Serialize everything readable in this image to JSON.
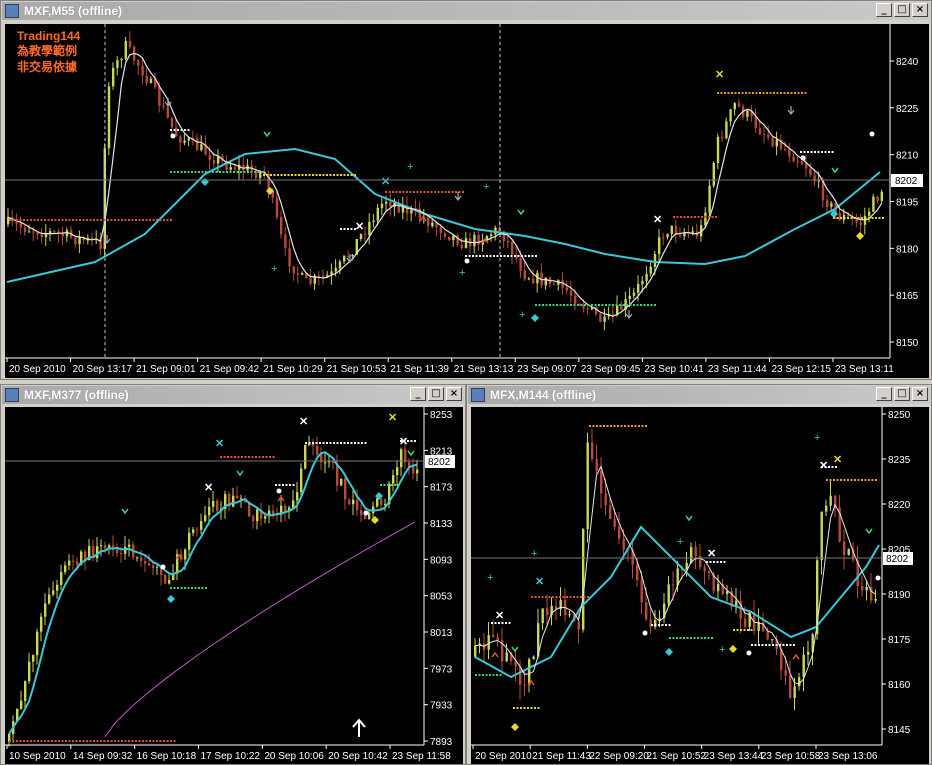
{
  "windows": {
    "top": {
      "title": "MXF,M55 (offline)",
      "watermark": [
        "Trading144",
        "為教學範例",
        "非交易依據"
      ],
      "price_ticks": [
        "8240",
        "8225",
        "8210",
        "8195",
        "8180",
        "8165",
        "8150"
      ],
      "current_price": "8202",
      "time_ticks": [
        "20 Sep 2010",
        "20 Sep 13:17",
        "21 Sep 09:01",
        "21 Sep 09:42",
        "21 Sep 10:29",
        "21 Sep 10:53",
        "21 Sep 11:39",
        "21 Sep 13:13",
        "23 Sep 09:07",
        "23 Sep 09:45",
        "23 Sep 10:41",
        "23 Sep 11:44",
        "23 Sep 12:15",
        "23 Sep 13:11"
      ]
    },
    "bottom_left": {
      "title": "MXF,M377 (offline)",
      "price_ticks": [
        "8253",
        "8213",
        "8173",
        "8133",
        "8093",
        "8053",
        "8013",
        "7973",
        "7933",
        "7893"
      ],
      "current_price": "8202",
      "time_ticks": [
        "10 Sep 2010",
        "14 Sep 09:32",
        "16 Sep 10:18",
        "17 Sep 10:22",
        "20 Sep 10:06",
        "20 Sep 10:42",
        "23 Sep 11:58"
      ]
    },
    "bottom_right": {
      "title": "MFX,M144 (offline)",
      "price_ticks": [
        "8250",
        "8235",
        "8220",
        "8205",
        "8190",
        "8175",
        "8160",
        "8145"
      ],
      "current_price": "8202",
      "time_ticks": [
        "20 Sep 2010",
        "21 Sep 11:43",
        "22 Sep 09:20",
        "21 Sep 10:52",
        "23 Sep 13:44",
        "23 Sep 10:58",
        "23 Sep 13:06"
      ]
    }
  },
  "buttons": {
    "minimize": "_",
    "maximize": "□",
    "close": "×"
  },
  "colors": {
    "up_candle": "#c8d85a",
    "down_candle": "#b84a3c",
    "ma_fast": "#e6e6e6",
    "ma_slow": "#39c8d8",
    "ma_long": "#c05ac8",
    "resistance": "#e0542c",
    "support": "#3cd27a",
    "orange_level": "#e89a2c",
    "yellow_level": "#e8d82c",
    "watermark": "#ff6a2a",
    "grid": "#7a7a7a"
  }
}
